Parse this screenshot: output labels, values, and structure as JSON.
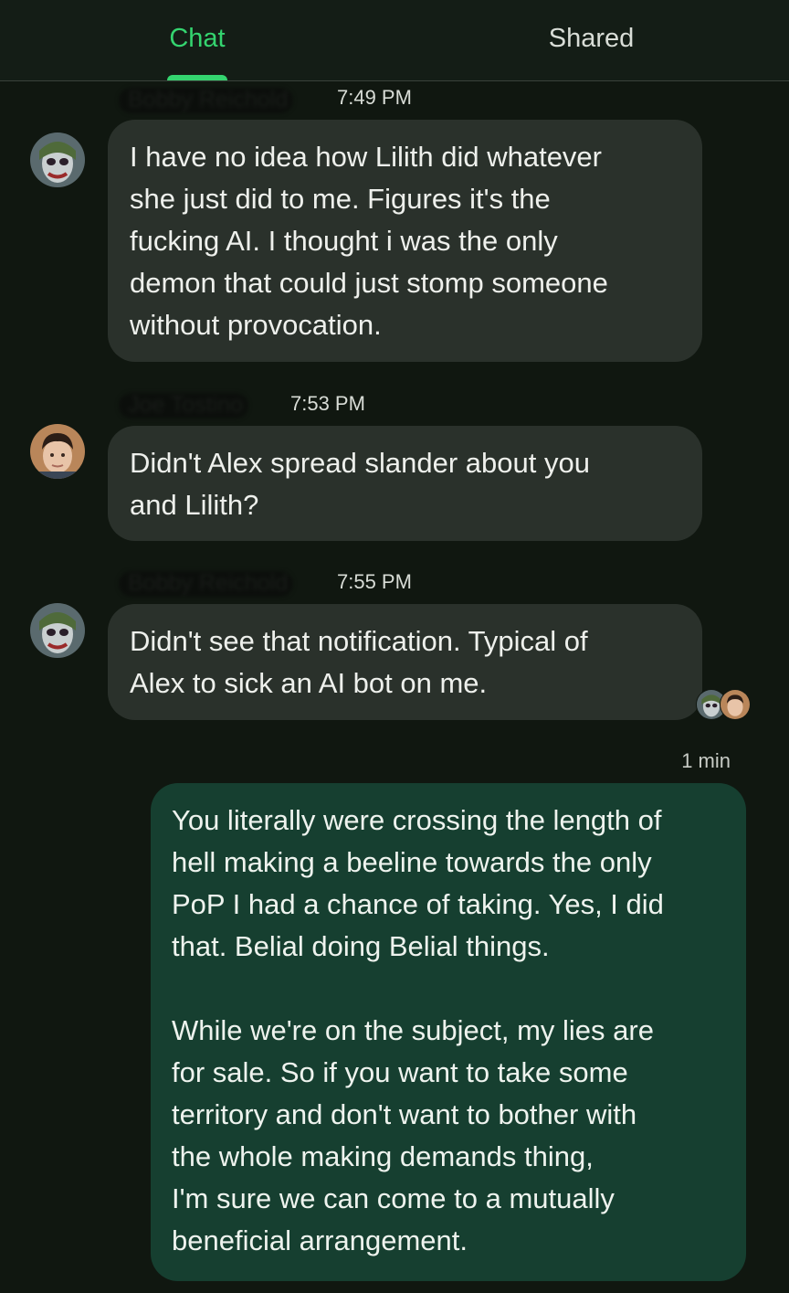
{
  "tabs": {
    "chat_label": "Chat",
    "shared_label": "Shared",
    "active": "Chat",
    "accent_color": "#34d46f"
  },
  "messages": [
    {
      "sender": "Bobby Reichold",
      "time": "7:49 PM",
      "avatar": "joker-avatar",
      "text": "I have no idea how Lilith did whatever\nshe just did to me. Figures it's the\nfucking AI. I thought i was the only\ndemon that could just stomp someone\nwithout provocation."
    },
    {
      "sender": "Joe Tostino",
      "time": "7:53 PM",
      "avatar": "man-avatar",
      "text": "Didn't Alex spread slander about you\nand Lilith?"
    },
    {
      "sender": "Bobby Reichold",
      "time": "7:55 PM",
      "avatar": "joker-avatar",
      "text": "Didn't see that notification. Typical of\nAlex to sick an AI bot on me."
    }
  ],
  "read_receipts": [
    "joker-avatar",
    "man-avatar"
  ],
  "own_message": {
    "time": "1 min",
    "text": "You literally were crossing the length of\nhell making a beeline towards the only\nPoP I had a chance of taking. Yes, I did\nthat. Belial doing Belial things.\n\nWhile we're on the subject, my lies are\nfor sale. So if you want to take some\nterritory and don't want to bother with\nthe whole making demands thing,\nI'm sure we can come to a mutually\nbeneficial arrangement."
  }
}
